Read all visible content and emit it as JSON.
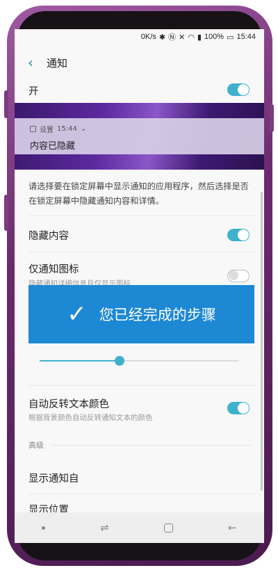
{
  "status_bar": {
    "network_speed": "0K/s",
    "battery": "100%",
    "time": "15:44"
  },
  "header": {
    "title": "通知"
  },
  "master_switch": {
    "label": "开",
    "on": true
  },
  "preview": {
    "app": "设置",
    "time": "15:44",
    "hidden_text": "内容已隐藏"
  },
  "description": "请选择要在锁定屏幕中显示通知的应用程序，然后选择是否在锁定屏幕中隐藏通知内容和详情。",
  "settings": [
    {
      "label": "隐藏内容",
      "on": true
    },
    {
      "label": "仅通知图标",
      "subtitle": "隐藏通知详细信息且仅显示图标",
      "on": false
    }
  ],
  "banner": {
    "text": "您已经完成的步骤"
  },
  "transparency_slider": {
    "value": 0.4
  },
  "auto_invert": {
    "label": "自动反转文本颜色",
    "subtitle": "根据背景颜色自动反转通知文本的颜色",
    "on": true
  },
  "advanced": {
    "section_label": "高级",
    "items": [
      "显示通知自",
      "显示位置"
    ]
  },
  "colors": {
    "accent": "#3fb1cd",
    "banner": "#1d88d4",
    "phone_body": "#6b2a6e"
  }
}
